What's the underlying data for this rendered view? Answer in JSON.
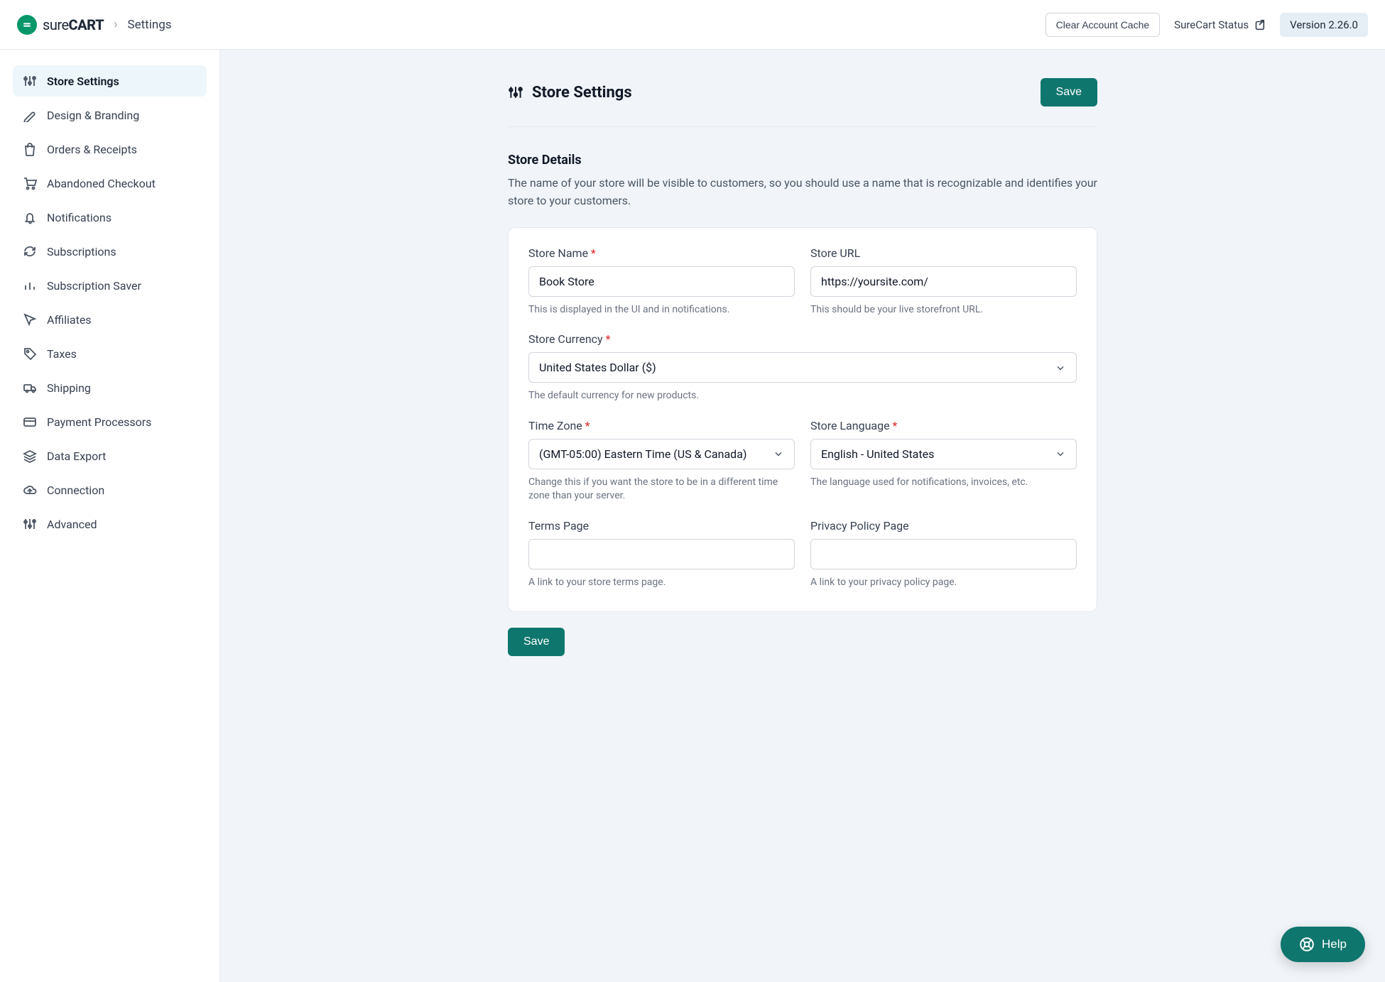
{
  "header": {
    "brand_part1": "sure",
    "brand_part2": "CART",
    "breadcrumb": "Settings",
    "clear_cache_label": "Clear Account Cache",
    "status_label": "SureCart Status",
    "version_label": "Version 2.26.0"
  },
  "sidebar": {
    "items": [
      {
        "label": "Store Settings",
        "icon": "sliders-icon",
        "active": true
      },
      {
        "label": "Design & Branding",
        "icon": "pen-icon",
        "active": false
      },
      {
        "label": "Orders & Receipts",
        "icon": "bag-icon",
        "active": false
      },
      {
        "label": "Abandoned Checkout",
        "icon": "cart-icon",
        "active": false
      },
      {
        "label": "Notifications",
        "icon": "bell-icon",
        "active": false
      },
      {
        "label": "Subscriptions",
        "icon": "refresh-icon",
        "active": false
      },
      {
        "label": "Subscription Saver",
        "icon": "bars-icon",
        "active": false
      },
      {
        "label": "Affiliates",
        "icon": "cursor-icon",
        "active": false
      },
      {
        "label": "Taxes",
        "icon": "tag-icon",
        "active": false
      },
      {
        "label": "Shipping",
        "icon": "truck-icon",
        "active": false
      },
      {
        "label": "Payment Processors",
        "icon": "card-icon",
        "active": false
      },
      {
        "label": "Data Export",
        "icon": "stack-icon",
        "active": false
      },
      {
        "label": "Connection",
        "icon": "cloud-icon",
        "active": false
      },
      {
        "label": "Advanced",
        "icon": "sliders-icon",
        "active": false
      }
    ]
  },
  "page": {
    "title": "Store Settings",
    "save_label": "Save"
  },
  "section_store_details": {
    "title": "Store Details",
    "desc": "The name of your store will be visible to customers, so you should use a name that is recognizable and identifies your store to your customers."
  },
  "fields": {
    "store_name": {
      "label": "Store Name",
      "value": "Book Store",
      "hint": "This is displayed in the UI and in notifications."
    },
    "store_url": {
      "label": "Store URL",
      "value": "https://yoursite.com/",
      "hint": "This should be your live storefront URL."
    },
    "currency": {
      "label": "Store Currency",
      "value": "United States Dollar ($)",
      "hint": "The default currency for new products."
    },
    "timezone": {
      "label": "Time Zone",
      "value": "(GMT-05:00) Eastern Time (US & Canada)",
      "hint": "Change this if you want the store to be in a different time zone than your server."
    },
    "language": {
      "label": "Store Language",
      "value": "English - United States",
      "hint": "The language used for notifications, invoices, etc."
    },
    "terms": {
      "label": "Terms Page",
      "value": "",
      "hint": "A link to your store terms page."
    },
    "privacy": {
      "label": "Privacy Policy Page",
      "value": "",
      "hint": "A link to your privacy policy page."
    }
  },
  "help_label": "Help"
}
